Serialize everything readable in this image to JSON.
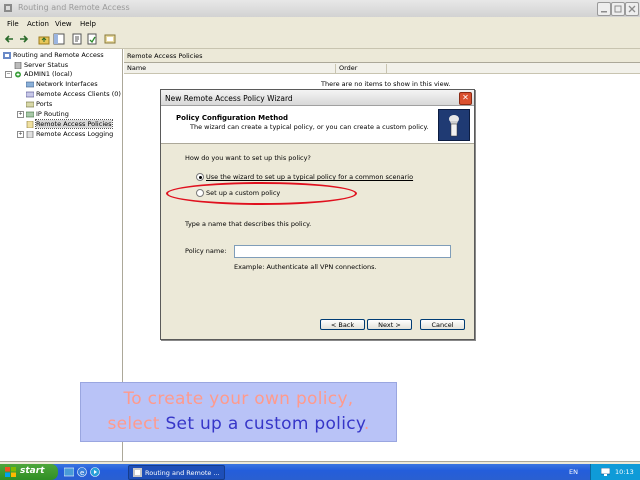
{
  "window": {
    "title": "Routing and Remote Access"
  },
  "menu": {
    "items": [
      "File",
      "Action",
      "View",
      "Help"
    ]
  },
  "tree": {
    "root": "Routing and Remote Access",
    "server_status": "Server Status",
    "server": "ADMIN1 (local)",
    "children": [
      "Network Interfaces",
      "Remote Access Clients (0)",
      "Ports",
      "IP Routing",
      "Remote Access Policies",
      "Remote Access Logging"
    ]
  },
  "pane": {
    "title": "Remote Access Policies",
    "col_name": "Name",
    "col_order": "Order",
    "empty_message": "There are no items to show in this view."
  },
  "dialog": {
    "title": "New Remote Access Policy Wizard",
    "close_glyph": "✕",
    "header_title": "Policy Configuration Method",
    "header_subtitle": "The wizard can create a typical policy, or you can create a custom policy.",
    "question": "How do you want to set up this policy?",
    "option_wizard": "Use the wizard to set up a typical policy for a common scenario",
    "option_custom": "Set up a custom policy",
    "name_prompt": "Type a name that describes this policy.",
    "policy_name_label": "Policy name:",
    "policy_name_value": "",
    "example": "Example: Authenticate all VPN connections.",
    "back_label": "< Back",
    "next_label": "Next >",
    "cancel_label": "Cancel"
  },
  "caption": {
    "line1": "To create your own policy,",
    "line2_prefix": "select ",
    "line2_highlight": "Set up a custom policy",
    "line2_suffix": "."
  },
  "taskbar": {
    "start_label": "start",
    "task_label": "Routing and Remote ...",
    "language": "EN",
    "clock": "10:13"
  },
  "colors": {
    "annotation_red": "#e0101e",
    "caption_bg": "#b9c3f7",
    "caption_text": "#ff9a8c",
    "caption_highlight": "#3636c8",
    "taskbar_blue": "#245edb",
    "start_green": "#3c9a2f"
  },
  "icons": {
    "app": "routing-app-icon",
    "back": "back-arrow-icon",
    "forward": "forward-arrow-icon",
    "wizard_header": "policy-wizard-icon"
  }
}
